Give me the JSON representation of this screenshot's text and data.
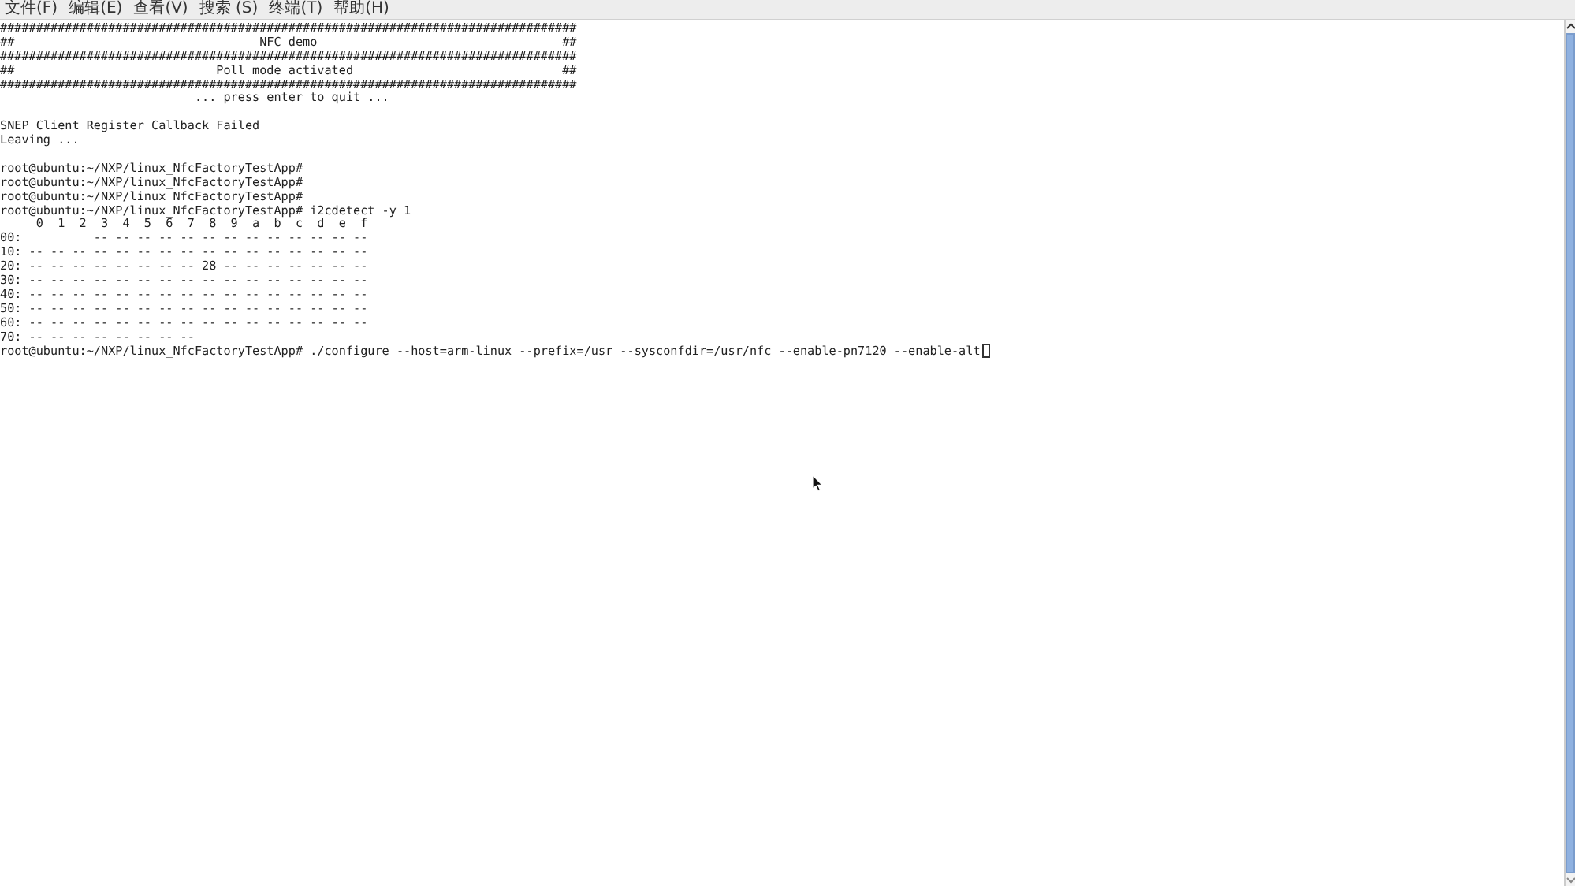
{
  "menu_bar": [
    "文件(F)",
    "编辑(E)",
    "查看(V)",
    "搜索 (S)",
    "终端(T)",
    "帮助(H)"
  ],
  "terminal": {
    "blocks": [
      [
        "################################################################################",
        "##                                  NFC demo                                  ##",
        "################################################################################",
        "##                            Poll mode activated                             ##",
        "################################################################################",
        "                           ... press enter to quit ..."
      ],
      [
        "SNEP Client Register Callback Failed",
        "Leaving ..."
      ],
      [
        "root@ubuntu:~/NXP/linux_NfcFactoryTestApp#",
        "root@ubuntu:~/NXP/linux_NfcFactoryTestApp#",
        "root@ubuntu:~/NXP/linux_NfcFactoryTestApp#",
        "root@ubuntu:~/NXP/linux_NfcFactoryTestApp# i2cdetect -y 1",
        "     0  1  2  3  4  5  6  7  8  9  a  b  c  d  e  f",
        "00:          -- -- -- -- -- -- -- -- -- -- -- -- --",
        "10: -- -- -- -- -- -- -- -- -- -- -- -- -- -- -- --",
        "20: -- -- -- -- -- -- -- -- 28 -- -- -- -- -- -- --",
        "30: -- -- -- -- -- -- -- -- -- -- -- -- -- -- -- --",
        "40: -- -- -- -- -- -- -- -- -- -- -- -- -- -- -- --",
        "50: -- -- -- -- -- -- -- -- -- -- -- -- -- -- -- --",
        "60: -- -- -- -- -- -- -- -- -- -- -- -- -- -- -- --",
        "70: -- -- -- -- -- -- -- --"
      ]
    ],
    "command_line": "root@ubuntu:~/NXP/linux_NfcFactoryTestApp# ./configure --host=arm-linux --prefix=/usr --sysconfdir=/usr/nfc --enable-pn7120 --enable-alt"
  }
}
